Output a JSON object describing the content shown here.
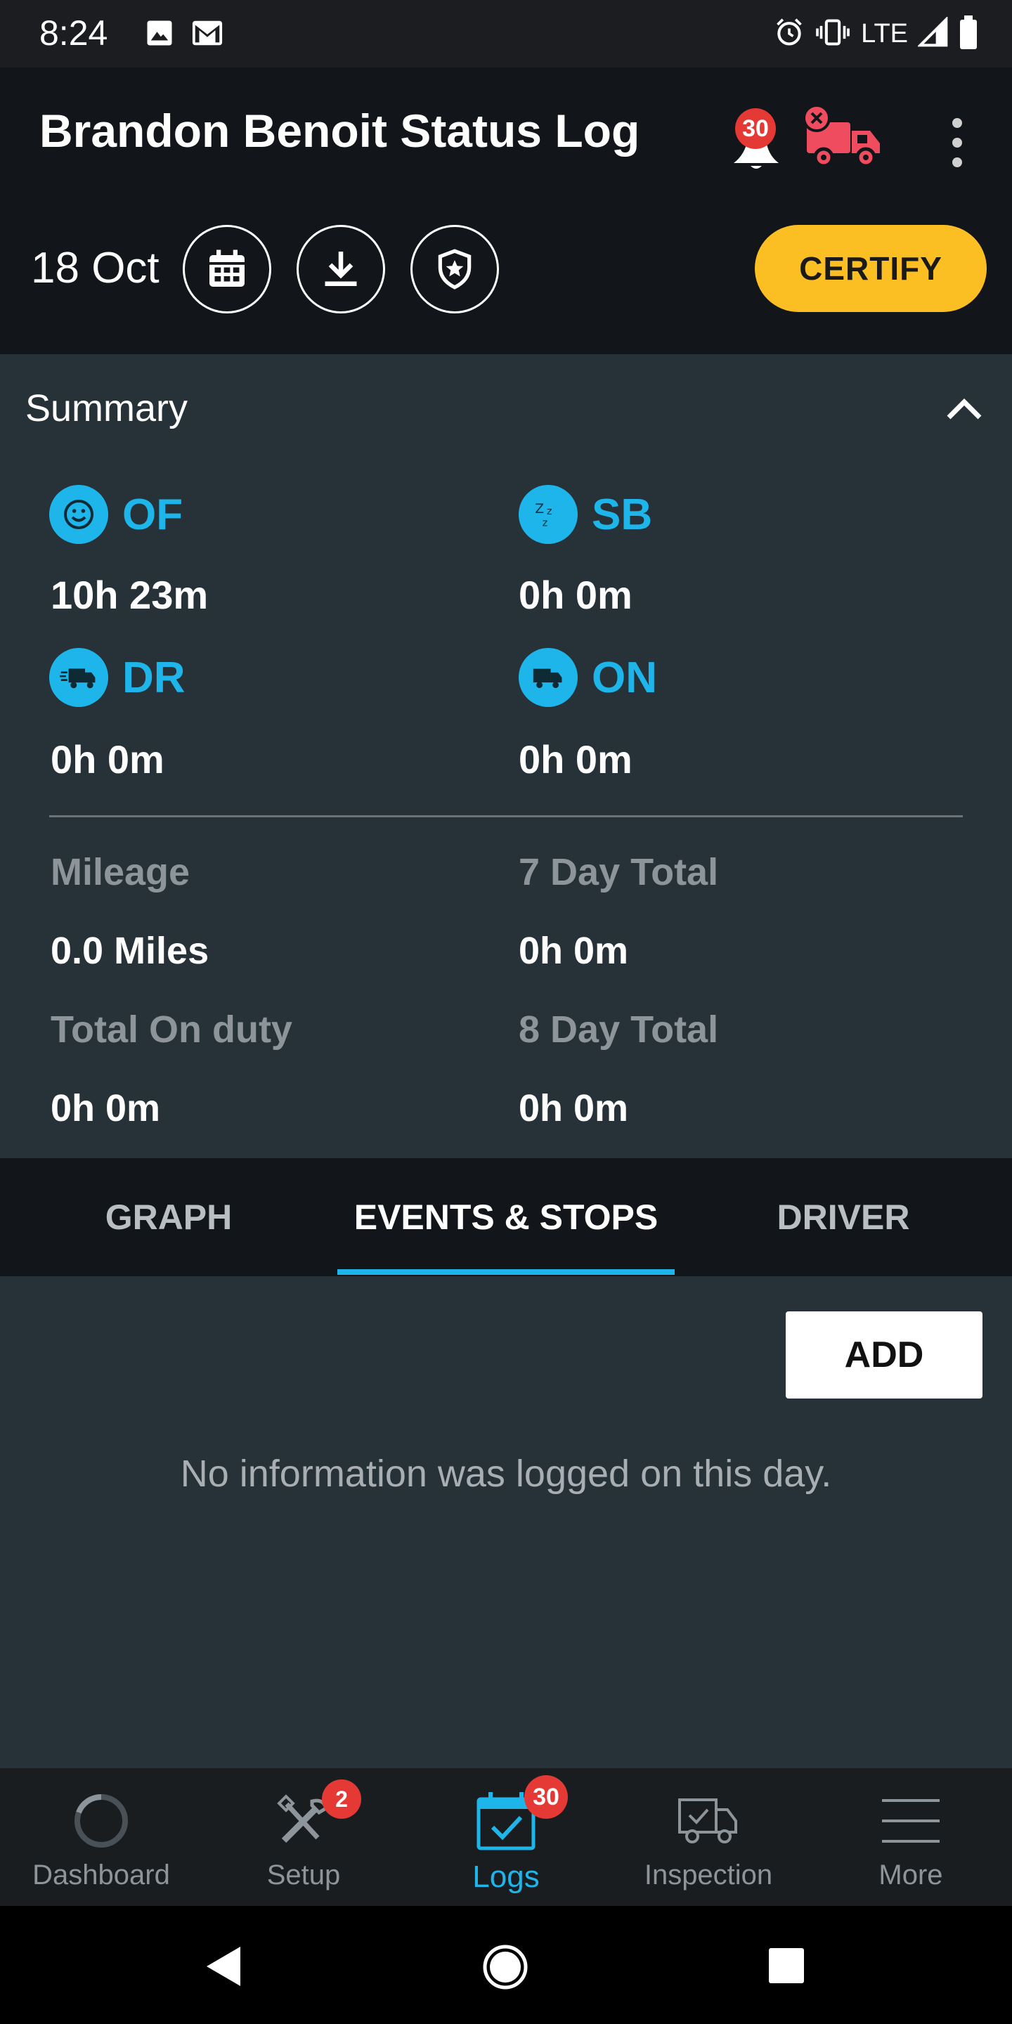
{
  "status_bar": {
    "time": "8:24",
    "network": "LTE",
    "icons": [
      "image-icon",
      "gmail-icon",
      "alarm-icon",
      "vibrate-icon",
      "signal-icon",
      "battery-icon"
    ]
  },
  "header": {
    "title": "Brandon Benoit Status Log",
    "notification_count": "30",
    "truck_status_icon": "truck-disconnected-icon",
    "date": "18 Oct",
    "certify_label": "CERTIFY",
    "accent_color": "#1eb6ea",
    "certify_color": "#fbbf24"
  },
  "summary": {
    "title": "Summary",
    "stats": [
      {
        "code": "OF",
        "value": "10h 23m",
        "icon": "smile-icon"
      },
      {
        "code": "SB",
        "value": "0h 0m",
        "icon": "sleep-icon"
      },
      {
        "code": "DR",
        "value": "0h 0m",
        "icon": "truck-driving-icon"
      },
      {
        "code": "ON",
        "value": "0h 0m",
        "icon": "truck-icon"
      }
    ],
    "mileage_label": "Mileage",
    "mileage_value": "0.0 Miles",
    "seven_day_label": "7 Day Total",
    "seven_day_value": "0h 0m",
    "on_duty_label": "Total On duty",
    "on_duty_value": "0h 0m",
    "eight_day_label": "8 Day Total",
    "eight_day_value": "0h 0m"
  },
  "tabs": [
    {
      "label": "GRAPH",
      "active": false
    },
    {
      "label": "EVENTS & STOPS",
      "active": true
    },
    {
      "label": "DRIVER",
      "active": false
    }
  ],
  "events": {
    "add_label": "ADD",
    "empty_message": "No information was logged on this day."
  },
  "bottom_nav": [
    {
      "label": "Dashboard",
      "icon": "dashboard-icon",
      "badge": ""
    },
    {
      "label": "Setup",
      "icon": "tools-icon",
      "badge": "2"
    },
    {
      "label": "Logs",
      "icon": "calendar-check-icon",
      "badge": "30",
      "active": true
    },
    {
      "label": "Inspection",
      "icon": "truck-check-icon",
      "badge": ""
    },
    {
      "label": "More",
      "icon": "menu-icon",
      "badge": ""
    }
  ]
}
